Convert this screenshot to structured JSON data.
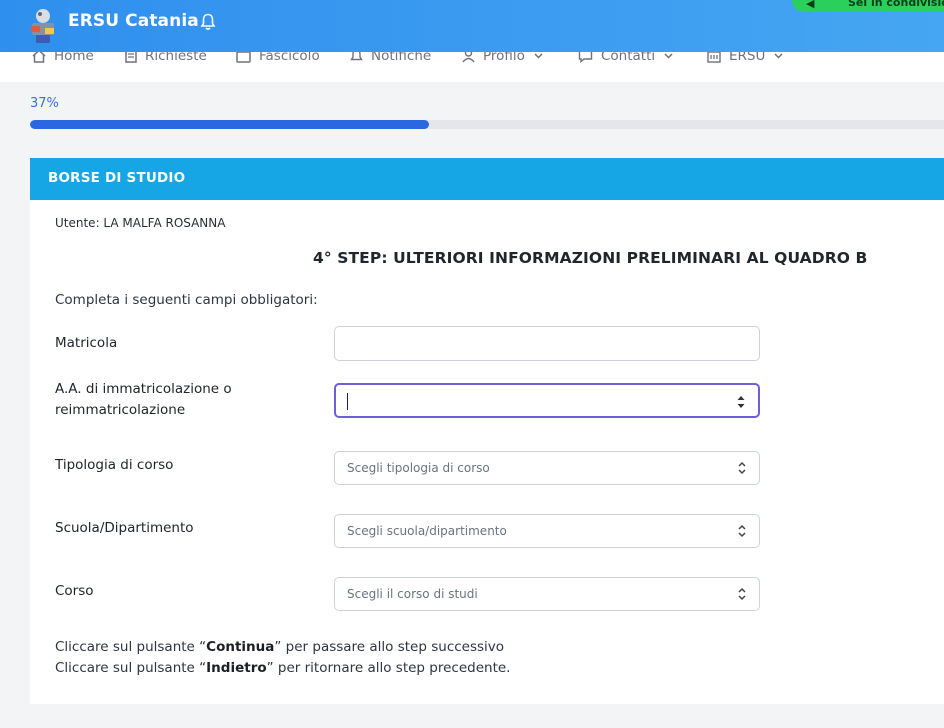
{
  "header": {
    "brand": "ERSU Catania",
    "share_text": "Sei in condivisione",
    "accent": "#3b9cf0",
    "share_color": "#2ad05b"
  },
  "nav": {
    "items": [
      {
        "label": "Home",
        "icon": "home-icon",
        "has_dropdown": false
      },
      {
        "label": "Richieste",
        "icon": "document-icon",
        "has_dropdown": false
      },
      {
        "label": "Fascicolo",
        "icon": "folder-icon",
        "has_dropdown": false
      },
      {
        "label": "Notifiche",
        "icon": "bell-icon",
        "has_dropdown": false
      },
      {
        "label": "Profilo",
        "icon": "user-icon",
        "has_dropdown": true
      },
      {
        "label": "Contatti",
        "icon": "chat-icon",
        "has_dropdown": true
      },
      {
        "label": "ERSU",
        "icon": "building-icon",
        "has_dropdown": true
      }
    ]
  },
  "progress": {
    "label": "37%",
    "value": 0.37,
    "color": "#2a67e0"
  },
  "card": {
    "title": "BORSE DI STUDIO",
    "header_color": "#16a6e6",
    "user_line": "Utente: LA MALFA ROSANNA",
    "step_title": "4° STEP: ULTERIORI INFORMAZIONI PRELIMINARI AL QUADRO B",
    "instructions": "Completa i seguenti campi obbligatori:"
  },
  "form": {
    "matricola": {
      "label": "Matricola",
      "value": ""
    },
    "anno": {
      "label_line1": "A.A. di immatricolazione o",
      "label_line2": "reimmatricolazione",
      "value": ""
    },
    "tipologia": {
      "label": "Tipologia di corso",
      "placeholder": "Scegli tipologia di corso"
    },
    "scuola": {
      "label": "Scuola/Dipartimento",
      "placeholder": "Scegli scuola/dipartimento"
    },
    "corso": {
      "label": "Corso",
      "placeholder": "Scegli il corso di studi"
    }
  },
  "footer": {
    "line1_pre": "Cliccare sul pulsante “",
    "line1_bold": "Continua",
    "line1_post": "” per passare allo step successivo",
    "line2_pre": "Cliccare sul pulsante “",
    "line2_bold": "Indietro",
    "line2_post": "” per ritornare allo step precedente."
  }
}
